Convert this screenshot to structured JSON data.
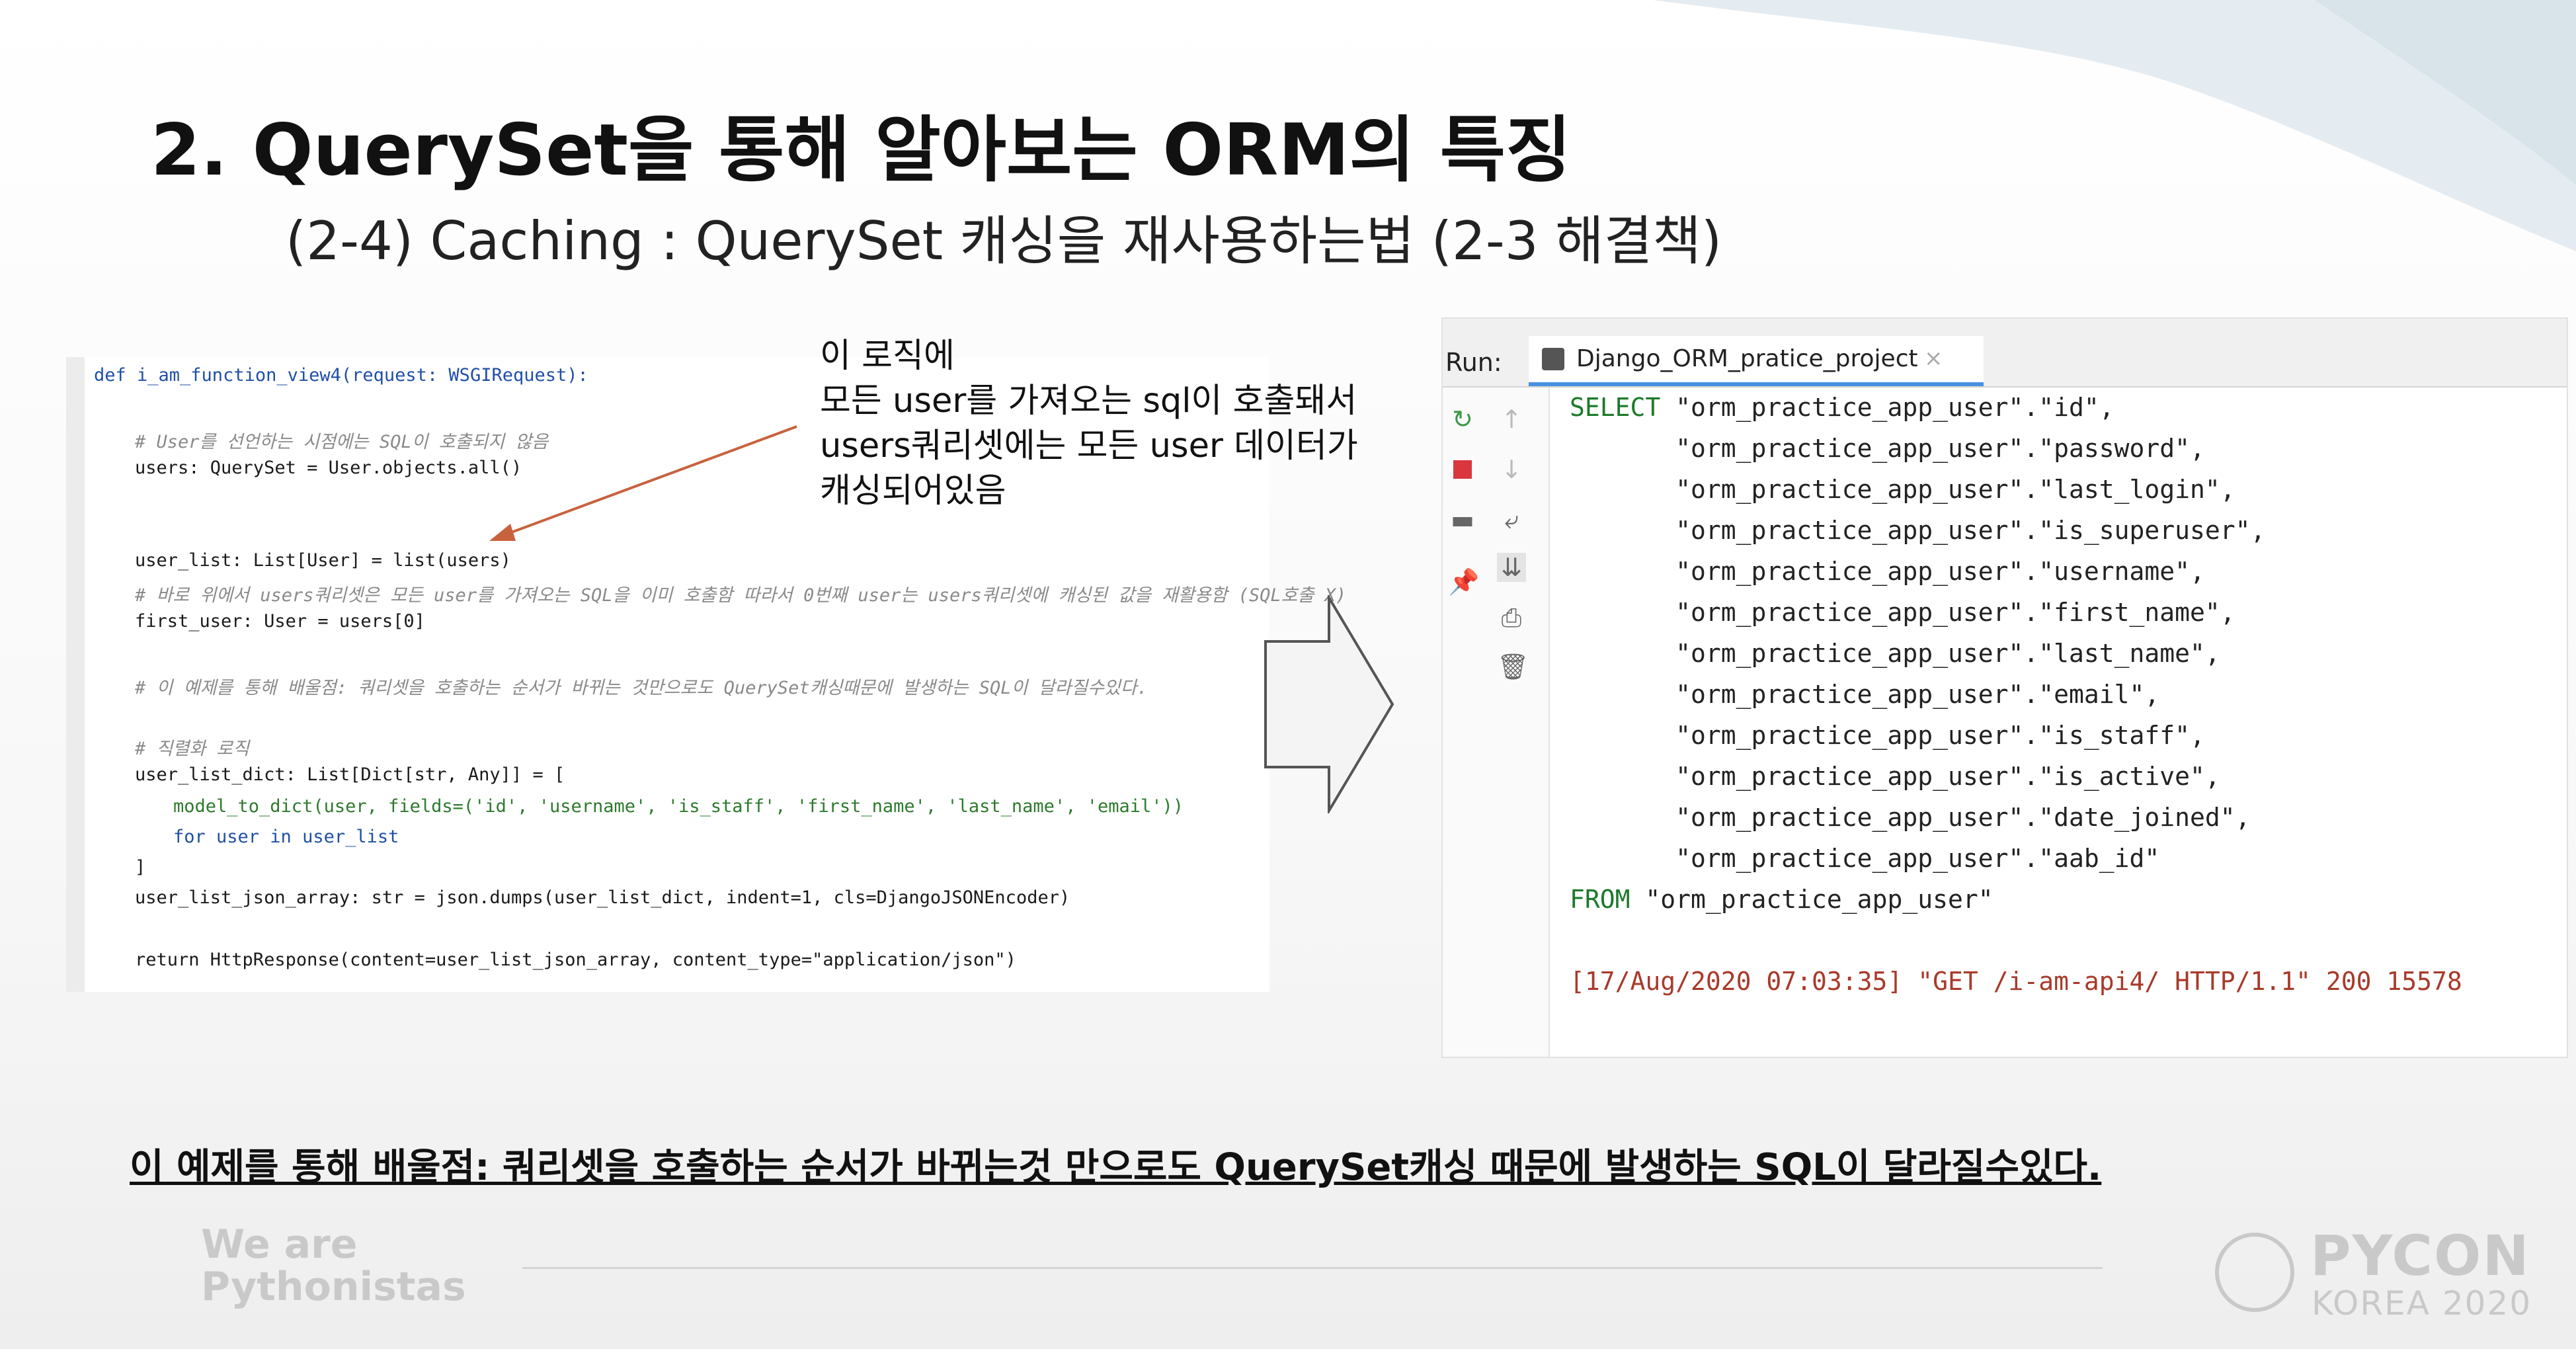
{
  "slide": {
    "title": "2. QuerySet을 통해 알아보는 ORM의 특징",
    "subtitle": "(2-4) Caching : QuerySet 캐싱을 재사용하는법 (2-3 해결책)",
    "note_lines": [
      "이 로직에",
      "모든 user를 가져오는 sql이 호출돼서",
      "users쿼리셋에는 모든 user 데이터가",
      "캐싱되어있음"
    ],
    "bottom_note": "이 예제를 통해 배울점: 쿼리셋을 호출하는 순서가 바뀌는것 만으로도 QuerySet캐싱 때문에 발생하는 SQL이 달라질수있다.",
    "footer_left_1": "We are",
    "footer_left_2": "Pythonistas",
    "logo_line_1": "PYCON",
    "logo_line_2": "KOREA 2020"
  },
  "code": {
    "lines": [
      "def i_am_function_view4(request: WSGIRequest):",
      "# User를 선언하는 시점에는 SQL이 호출되지 않음",
      "users: QuerySet = User.objects.all()",
      "user_list: List[User] = list(users)",
      "# 바로 위에서 users쿼리셋은 모든 user를 가져오는 SQL을 이미 호출함 따라서 0번째 user는 users쿼리셋에 캐싱된 값을 재활용함 (SQL호출 X)",
      "first_user: User = users[0]",
      "# 이 예제를 통해 배울점: 쿼리셋을 호출하는 순서가 바뀌는 것만으로도 QuerySet캐싱때문에 발생하는 SQL이 달라질수있다.",
      "# 직렬화 로직",
      "user_list_dict: List[Dict[str, Any]] = [",
      "model_to_dict(user, fields=('id', 'username', 'is_staff', 'first_name', 'last_name', 'email'))",
      "for user in user_list",
      "]",
      "user_list_json_array: str = json.dumps(user_list_dict, indent=1, cls=DjangoJSONEncoder)",
      "return HttpResponse(content=user_list_json_array, content_type=\"application/json\")"
    ]
  },
  "run_panel": {
    "label": "Run:",
    "tab_title": "Django_ORM_pratice_project",
    "tab_close": "×",
    "sql_lines": [
      "SELECT \"orm_practice_app_user\".\"id\",",
      "       \"orm_practice_app_user\".\"password\",",
      "       \"orm_practice_app_user\".\"last_login\",",
      "       \"orm_practice_app_user\".\"is_superuser\",",
      "       \"orm_practice_app_user\".\"username\",",
      "       \"orm_practice_app_user\".\"first_name\",",
      "       \"orm_practice_app_user\".\"last_name\",",
      "       \"orm_practice_app_user\".\"email\",",
      "       \"orm_practice_app_user\".\"is_staff\",",
      "       \"orm_practice_app_user\".\"is_active\",",
      "       \"orm_practice_app_user\".\"date_joined\",",
      "       \"orm_practice_app_user\".\"aab_id\"",
      "FROM \"orm_practice_app_user\""
    ],
    "log_line": "[17/Aug/2020 07:03:35] \"GET /i-am-api4/ HTTP/1.1\" 200 15578",
    "tools": {
      "rerun": "rerun-icon",
      "stop": "stop-icon",
      "layout": "layout-icon",
      "pin": "pin-icon",
      "up": "arrow-up-icon",
      "down": "arrow-down-icon",
      "wrap": "soft-wrap-icon",
      "scroll": "scroll-to-end-icon",
      "print": "print-icon",
      "trash": "trash-icon"
    }
  },
  "colors": {
    "accent": "#4a90e2",
    "arrow_line": "#c8623e",
    "sql_keyword": "#1c7a2b",
    "log_text": "#a83a2a",
    "stop": "#d9363e",
    "rerun": "#3c9a46"
  }
}
